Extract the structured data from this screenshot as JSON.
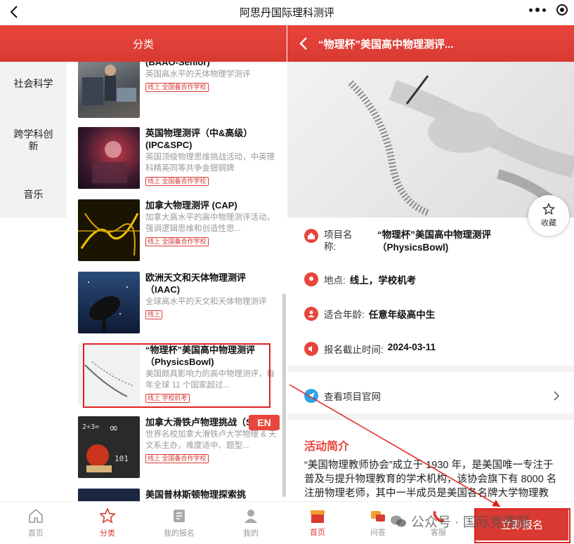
{
  "topbar": {
    "title": "阿思丹国际理科测评"
  },
  "left": {
    "header": "分类",
    "categories": [
      "社会科学",
      "跨学科创新",
      "音乐"
    ],
    "items": [
      {
        "name": "(BAAO-Senior)",
        "desc": "英国高水平的天体物理学测评",
        "tag": "线上 全国备合作学校"
      },
      {
        "name": "英国物理测评（中&高级）(IPC&SPC)",
        "desc": "英国顶级物理思维挑战活动，中英理科精英同等共争金银铜牌",
        "tag": "线上 全国备合作学校"
      },
      {
        "name": "加拿大物理测评 (CAP)",
        "desc": "加拿大高水平的高中物理测评活动，强调逻辑思维和创造性思...",
        "tag": "线上 全国备合作学校"
      },
      {
        "name": "欧洲天文和天体物理测评（IAAC)",
        "desc": "全球高水平的天文和天体物理测评",
        "tag": "线上"
      },
      {
        "name": "“物理杯”美国高中物理测评（PhysicsBowl)",
        "desc": "美国颇具影响力的高中物理测评，每年全球 11 个国家超过...",
        "tag": "线上 学校机考"
      },
      {
        "name": "加拿大滑铁卢物理挑战（S",
        "desc": "世界名校加拿大滑铁卢大学物理 & 天文系主办，难度适中、题型...",
        "tag": "线上 全国备合作学校"
      },
      {
        "name": "美国普林斯顿物理探索挑",
        "desc": "",
        "tag": ""
      }
    ],
    "en_badge": "EN",
    "tabs": [
      {
        "label": "首页"
      },
      {
        "label": "分类"
      },
      {
        "label": "我的报名"
      },
      {
        "label": "我的"
      }
    ]
  },
  "right": {
    "header": "“物理杯”美国高中物理测评...",
    "fav": "收藏",
    "project_label": "项目名称:",
    "project_value": "“物理杯”美国高中物理测评（PhysicsBowl)",
    "location_label": "地点:",
    "location_value": "线上，学校机考",
    "age_label": "适合年龄:",
    "age_value": "任意年级高中生",
    "deadline_label": "报名截止时间:",
    "deadline_value": "2024-03-11",
    "website": "查看项目官网",
    "section_title": "活动简介",
    "intro": "“美国物理教师协会”成立于 1930 年，是美国唯一专注于普及与提升物理教育的学术机构，该协会旗下有 8000 名注册物理老师，其中一半成员是美国各名牌大学物理教授，约三分之一成员是美国高中的有经验的物",
    "tabs": [
      {
        "label": "首页"
      },
      {
        "label": "问答"
      },
      {
        "label": "客服"
      }
    ],
    "signup": "立即报名"
  },
  "watermark": "公众号 · 国际竞赛圈",
  "colors": {
    "brand_red": "#d93a32",
    "link_blue": "#2ba5e8"
  }
}
